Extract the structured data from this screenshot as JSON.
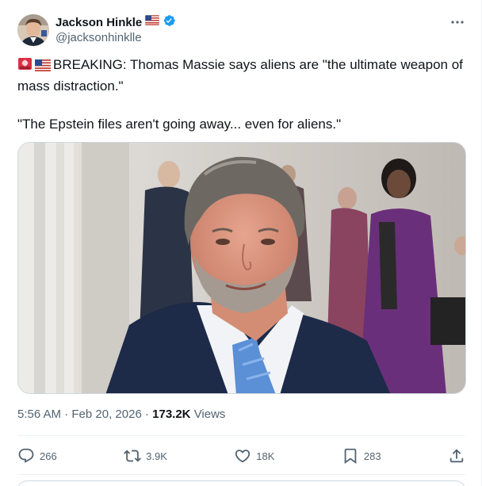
{
  "author": {
    "display_name": "Jackson Hinkle",
    "handle": "@jacksonhinklle",
    "verified": true,
    "flag": "us-flag-icon"
  },
  "tweet": {
    "line1": "BREAKING: Thomas Massie says aliens are \"the ultimate weapon of mass distraction.\"",
    "line2": "\"The Epstein files aren't going away... even for aliens.\"",
    "prefix_emojis": [
      "police-light-icon",
      "us-flag-icon"
    ]
  },
  "meta": {
    "time": "5:56 AM",
    "separator": "·",
    "date": "Feb 20, 2026",
    "views_count": "173.2K",
    "views_label": "Views"
  },
  "actions": {
    "replies": "266",
    "reposts": "3.9K",
    "likes": "18K",
    "bookmarks": "283"
  },
  "colors": {
    "text": "#0f1419",
    "secondary": "#536471",
    "verified": "#1d9bf0",
    "border": "#cfd9de"
  }
}
